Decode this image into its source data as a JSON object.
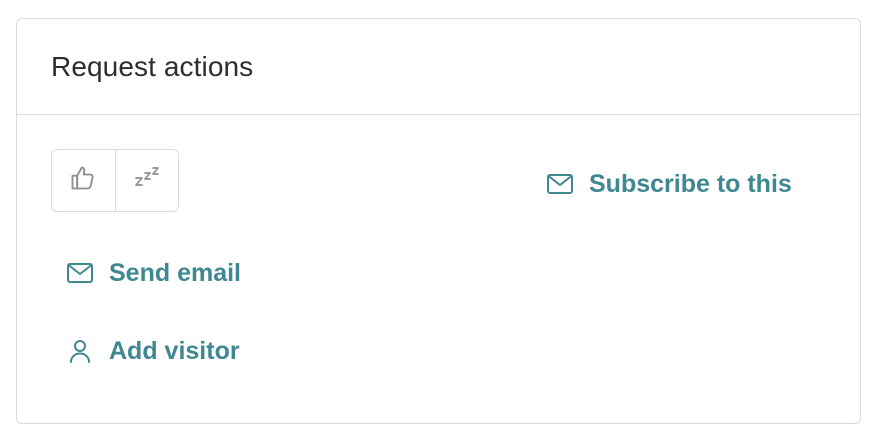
{
  "panel": {
    "title": "Request actions"
  },
  "vote": {
    "like_icon": "thumbs-up-icon",
    "snooze_icon": "snooze-zzz-icon",
    "snooze_glyph": "zzz"
  },
  "actions": {
    "subscribe_label": "Subscribe to this",
    "subscribe_icon": "mail-icon",
    "send_email_label": "Send email",
    "send_email_icon": "mail-icon",
    "add_visitor_label": "Add visitor",
    "add_visitor_icon": "person-icon"
  },
  "colors": {
    "accent": "#3f8791",
    "border": "#d9dbe0",
    "icon_muted": "#8a8f96",
    "text": "#2a2d31"
  }
}
